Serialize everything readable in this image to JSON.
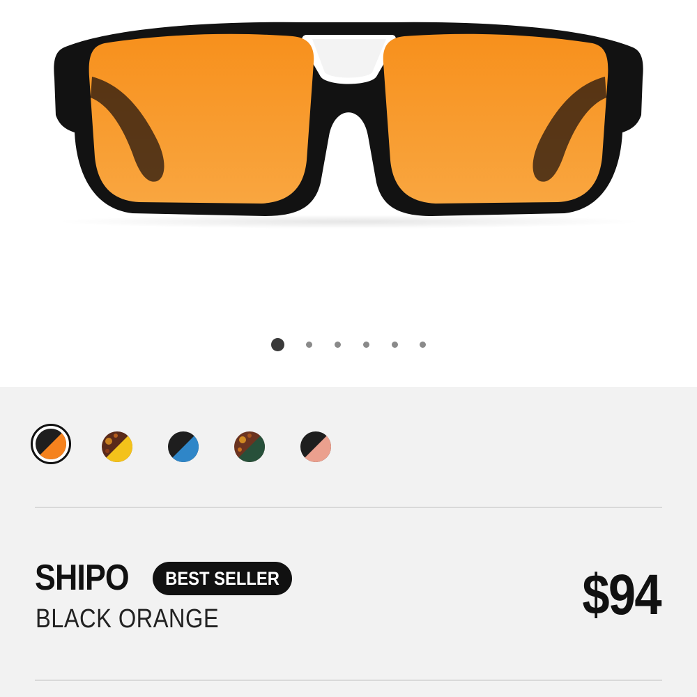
{
  "product": {
    "name": "SHIPO",
    "badge": "BEST SELLER",
    "color_name": "BLACK ORANGE",
    "price": "$94",
    "image_icon": "sunglasses-image"
  },
  "carousel": {
    "total": 6,
    "active_index": 0
  },
  "swatches": [
    {
      "name": "black-orange",
      "top": "#1e1e1e",
      "bottom": "#f5821e",
      "selected": true
    },
    {
      "name": "tortoise-yellow",
      "top": "#5a2a1a",
      "bottom": "#f3c21b",
      "selected": false
    },
    {
      "name": "black-blue",
      "top": "#1e1e1e",
      "bottom": "#2f86c8",
      "selected": false
    },
    {
      "name": "tortoise-green",
      "top": "#6b3320",
      "bottom": "#27503a",
      "selected": false
    },
    {
      "name": "black-pink",
      "top": "#1e1e1e",
      "bottom": "#eba08e",
      "selected": false
    }
  ],
  "colors": {
    "lens": "#f7941f",
    "frame": "#111111",
    "info_bg": "#f2f2f2"
  }
}
